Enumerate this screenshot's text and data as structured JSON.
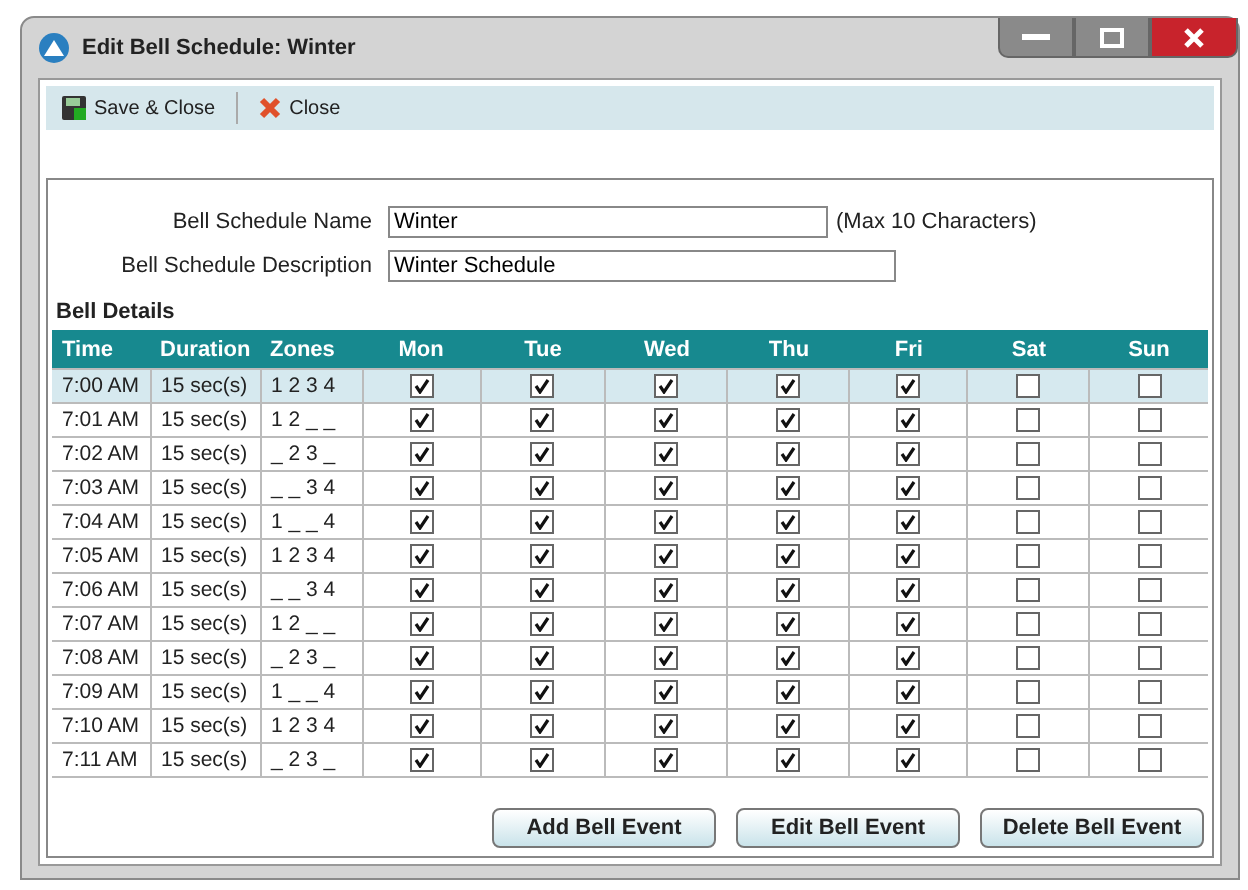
{
  "window": {
    "title": "Edit Bell Schedule: Winter"
  },
  "toolbar": [
    {
      "label": "Save & Close",
      "kind": "save"
    },
    {
      "label": "Close",
      "kind": "close"
    }
  ],
  "form": {
    "name_label": "Bell Schedule Name",
    "name_value": "Winter",
    "name_hint": "(Max 10 Characters)",
    "description_label": "Bell Schedule Description",
    "description_value": "Winter Schedule"
  },
  "section_title": "Bell Details",
  "table": {
    "columns": [
      "Time",
      "Duration",
      "Zones",
      "Mon",
      "Tue",
      "Wed",
      "Thu",
      "Fri",
      "Sat",
      "Sun"
    ],
    "rows": [
      {
        "time": "7:00 AM",
        "duration": "15 sec(s)",
        "zones": "1 2 3 4",
        "selected": true,
        "days": [
          true,
          true,
          true,
          true,
          true,
          false,
          false
        ]
      },
      {
        "time": "7:01 AM",
        "duration": "15 sec(s)",
        "zones": "1 2 _ _",
        "selected": false,
        "days": [
          true,
          true,
          true,
          true,
          true,
          false,
          false
        ]
      },
      {
        "time": "7:02 AM",
        "duration": "15 sec(s)",
        "zones": "_ 2 3 _",
        "selected": false,
        "days": [
          true,
          true,
          true,
          true,
          true,
          false,
          false
        ]
      },
      {
        "time": "7:03 AM",
        "duration": "15 sec(s)",
        "zones": "_ _ 3 4",
        "selected": false,
        "days": [
          true,
          true,
          true,
          true,
          true,
          false,
          false
        ]
      },
      {
        "time": "7:04 AM",
        "duration": "15 sec(s)",
        "zones": "1 _ _ 4",
        "selected": false,
        "days": [
          true,
          true,
          true,
          true,
          true,
          false,
          false
        ]
      },
      {
        "time": "7:05 AM",
        "duration": "15 sec(s)",
        "zones": "1 2 3 4",
        "selected": false,
        "days": [
          true,
          true,
          true,
          true,
          true,
          false,
          false
        ]
      },
      {
        "time": "7:06 AM",
        "duration": "15 sec(s)",
        "zones": "_ _ 3 4",
        "selected": false,
        "days": [
          true,
          true,
          true,
          true,
          true,
          false,
          false
        ]
      },
      {
        "time": "7:07 AM",
        "duration": "15 sec(s)",
        "zones": "1 2 _ _",
        "selected": false,
        "days": [
          true,
          true,
          true,
          true,
          true,
          false,
          false
        ]
      },
      {
        "time": "7:08 AM",
        "duration": "15 sec(s)",
        "zones": "_ 2 3 _",
        "selected": false,
        "days": [
          true,
          true,
          true,
          true,
          true,
          false,
          false
        ]
      },
      {
        "time": "7:09 AM",
        "duration": "15 sec(s)",
        "zones": "1 _ _ 4",
        "selected": false,
        "days": [
          true,
          true,
          true,
          true,
          true,
          false,
          false
        ]
      },
      {
        "time": "7:10 AM",
        "duration": "15 sec(s)",
        "zones": "1 2 3 4",
        "selected": false,
        "days": [
          true,
          true,
          true,
          true,
          true,
          false,
          false
        ]
      },
      {
        "time": "7:11 AM",
        "duration": "15 sec(s)",
        "zones": "_ 2 3 _",
        "selected": false,
        "days": [
          true,
          true,
          true,
          true,
          true,
          false,
          false
        ]
      }
    ]
  },
  "buttons": [
    "Add Bell Event",
    "Edit Bell Event",
    "Delete Bell Event"
  ]
}
